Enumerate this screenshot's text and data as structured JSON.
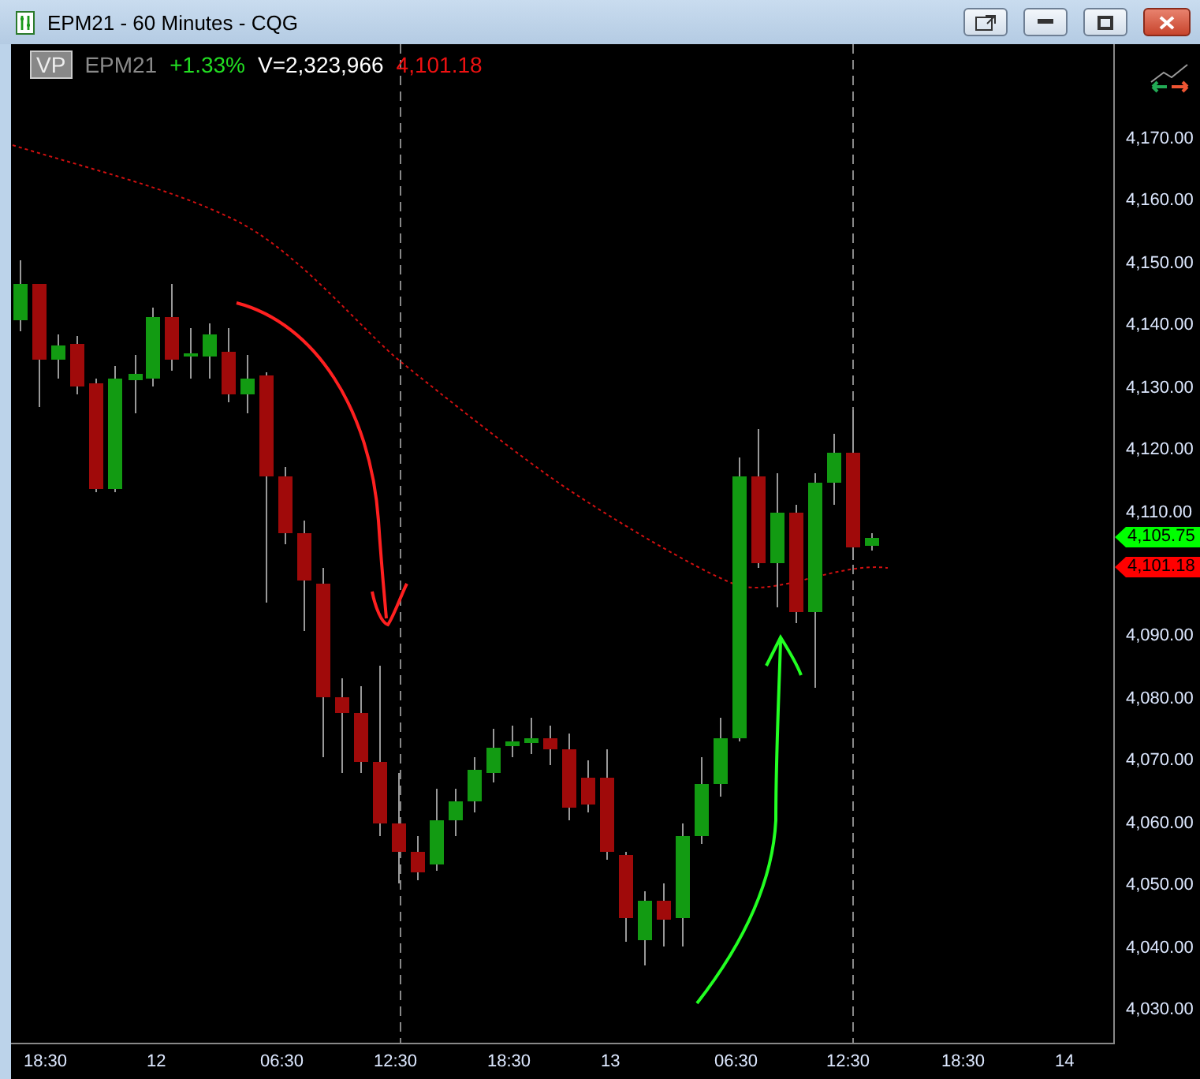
{
  "window": {
    "title": "EPM21 - 60 Minutes - CQG"
  },
  "header": {
    "badge": "VP",
    "symbol": "EPM21",
    "change": "+1.33%",
    "volume": "V=2,323,966",
    "last": "4,101.18"
  },
  "price_axis": {
    "labels": [
      "4,170.00",
      "4,160.00",
      "4,150.00",
      "4,140.00",
      "4,130.00",
      "4,120.00",
      "4,110.00",
      "4,090.00",
      "4,080.00",
      "4,070.00",
      "4,060.00",
      "4,050.00",
      "4,040.00",
      "4,030.00"
    ]
  },
  "price_markers": [
    {
      "label": "4,105.75",
      "color": "#00ff00"
    },
    {
      "label": "4,101.18",
      "color": "#ff0000"
    }
  ],
  "time_axis": {
    "labels": [
      "18:30",
      "12",
      "06:30",
      "12:30",
      "18:30",
      "13",
      "06:30",
      "12:30",
      "18:30",
      "14"
    ]
  }
}
